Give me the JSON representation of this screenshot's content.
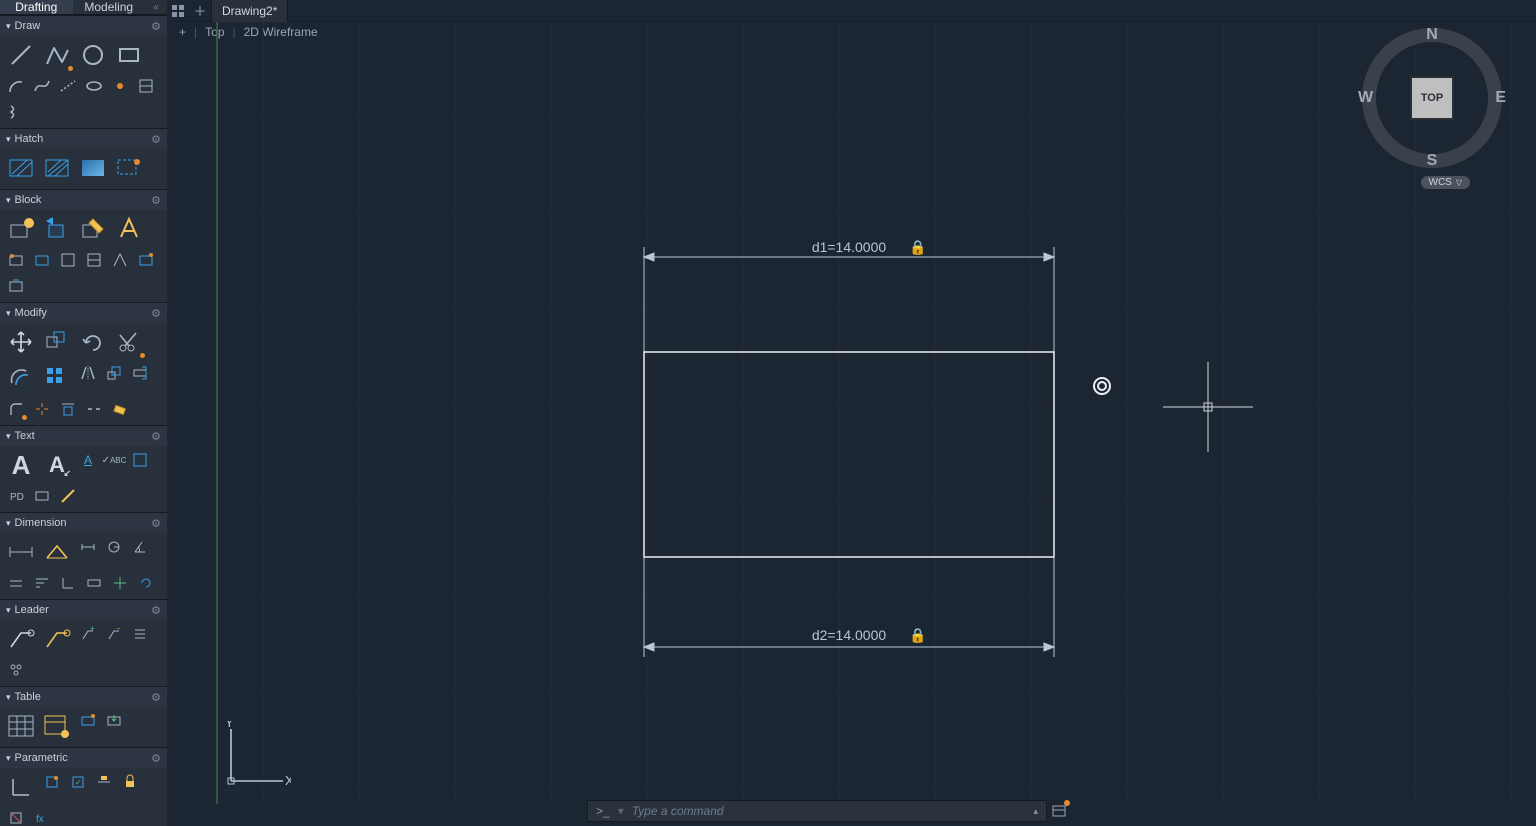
{
  "tabs": {
    "drafting": "Drafting",
    "modeling": "Modeling"
  },
  "doc_name": "Drawing2*",
  "view": {
    "name": "Top",
    "style": "2D Wireframe"
  },
  "sections": {
    "draw": "Draw",
    "hatch": "Hatch",
    "block": "Block",
    "modify": "Modify",
    "text": "Text",
    "dimension": "Dimension",
    "leader": "Leader",
    "table": "Table",
    "parametric": "Parametric"
  },
  "dims": {
    "d1": "d1=14.0000",
    "d2": "d2=14.0000"
  },
  "navcube": {
    "face": "TOP",
    "n": "N",
    "s": "S",
    "e": "E",
    "w": "W"
  },
  "wcs": "WCS",
  "axis": {
    "x": "X",
    "y": "Y"
  },
  "command": {
    "placeholder": "Type a command",
    "prompt": ">_"
  }
}
